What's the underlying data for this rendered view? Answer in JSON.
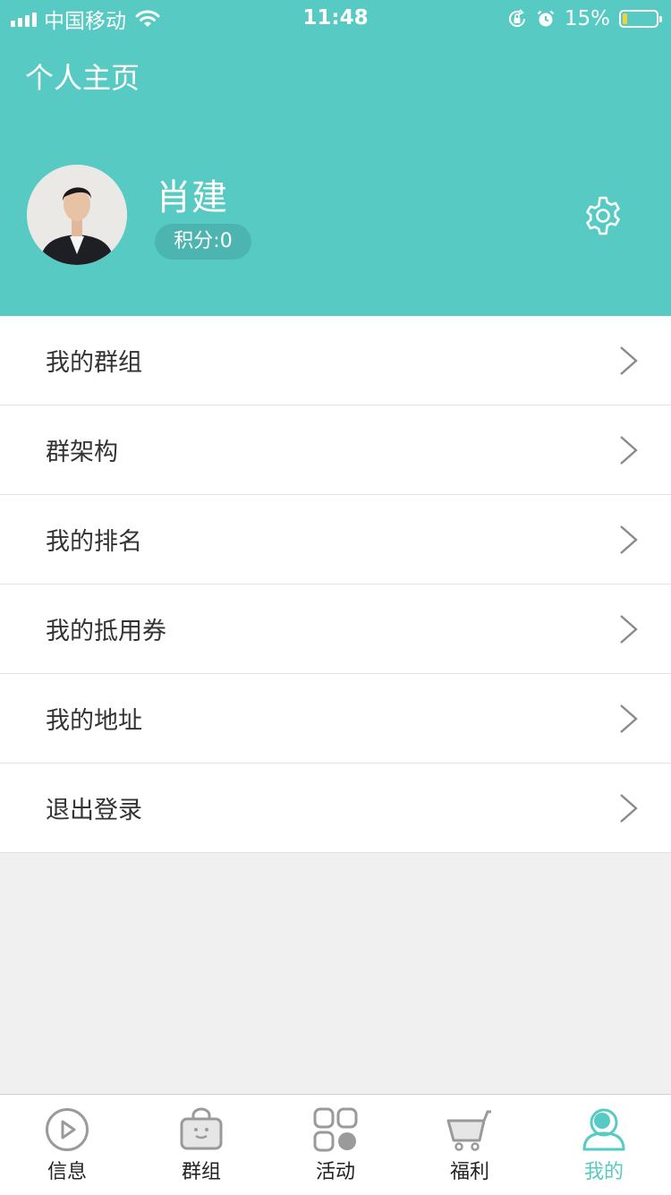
{
  "status_bar": {
    "carrier": "中国移动",
    "time": "11:48",
    "battery": "15%",
    "battery_level": 0.15
  },
  "header": {
    "title": "个人主页",
    "user_name": "肖建",
    "points": "积分:0"
  },
  "menu": [
    {
      "label": "我的群组"
    },
    {
      "label": "群架构"
    },
    {
      "label": "我的排名"
    },
    {
      "label": "我的抵用券"
    },
    {
      "label": "我的地址"
    },
    {
      "label": "退出登录"
    }
  ],
  "tabbar": [
    {
      "label": "信息",
      "icon": "play-circle-icon"
    },
    {
      "label": "群组",
      "icon": "bag-icon"
    },
    {
      "label": "活动",
      "icon": "grid-icon"
    },
    {
      "label": "福利",
      "icon": "cart-icon"
    },
    {
      "label": "我的",
      "icon": "user-icon",
      "active": true
    }
  ],
  "colors": {
    "accent": "#56cac3",
    "background": "#f0f0f0"
  }
}
